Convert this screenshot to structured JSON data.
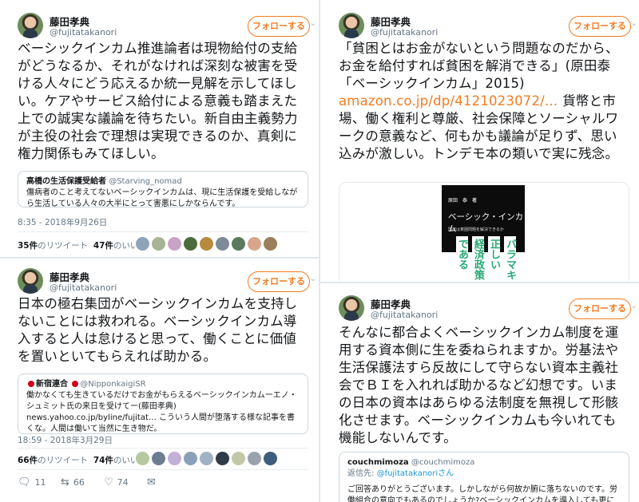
{
  "tweets": [
    {
      "user_name": "藤田孝典",
      "handle": "@fujitatakanori",
      "follow_label": "フォローする",
      "text": "ベーシックインカム推進論者は現物給付の支給がどうなるか、それがなければ深刻な被害を受ける人々にどう応えるか統一見解を示してほしい。ケアやサービス給付による意義も踏まえた上での誠実な議論を待ちたい。新自由主義勢力が主役の社会で理想は実現できるのか、真剣に権力関係もみてほしい。",
      "quote": {
        "name": "高橋の生活保護受給者",
        "handle": "@Starving_nomad",
        "body": "傷病者のこと考えてないベーシックインカムは、現に生活保護を受給しながら生活している人々の大半にとって害悪にしかならんです。"
      },
      "timestamp": "8:35 - 2018年9月26日",
      "retweets": "35件",
      "retweets_label": "のリツイート",
      "likes": "47件",
      "likes_label": "のいいね"
    },
    {
      "user_name": "藤田孝典",
      "handle": "@fujitatakanori",
      "follow_label": "フォローする",
      "text_before": "「貧困とはお金がないという問題なのだから、お金を給付すれば貧困を解消できる」(原田泰「ベーシックインカム」2015)",
      "link": "amazon.co.jp/dp/4121023072/…",
      "text_after": "貨幣と市場、働く権利と尊厳、社会保障とソーシャルワークの意義など、何もかも議論が足りず、思い込みが激しい。トンデモ本の類いで実に残念。",
      "book": {
        "author": "原田　泰　著",
        "title": "ベーシック・インカム",
        "subtitle": "国家は貧困問題を解決できるか",
        "vertical_lines": [
          "バラマキ",
          "正しい",
          "経済政策",
          "である"
        ]
      }
    },
    {
      "user_name": "藤田孝典",
      "handle": "@fujitatakanori",
      "follow_label": "フォローする",
      "text": "日本の極右集団がベーシックインカムを支持しないことには救われる。ベーシックインカム導入すると人は怠けると思って、働くことに価値を置いといてもらえれば助かる。",
      "quote": {
        "name": "新宿連合",
        "handle": "@NipponkaigiSR",
        "body": "働かなくても生きているだけでお金がもらえるベーシックインカムーエノ・シュミット氏の来日を受けてー(藤田孝典) news.yahoo.co.jp/byline/fujitat… こういう人間が堕落する様な記事を書くな。人間は働いて当然に生き物だ。"
      },
      "timestamp": "18:59 - 2018年3月29日",
      "retweets": "66件",
      "retweets_label": "のリツイート",
      "likes": "74件",
      "likes_label": "のいいね",
      "actions": {
        "reply": "11",
        "retweet": "66",
        "like": "74"
      }
    },
    {
      "user_name": "藤田孝典",
      "handle": "@fujitatakanori",
      "follow_label": "フォローする",
      "text": "そんなに都合よくベーシックインカム制度を運用する資本側に生を委ねられますか。労基法や生活保護法すら反故にして守らない資本主義社会でＢＩを入れれば助かるなど幻想です。いまの日本の資本はあらゆる法制度を無視して形骸化させます。ベーシックインカムも今いれても機能しないんです。",
      "reply": {
        "name": "couchmimoza",
        "handle": "@couchmimoza",
        "to_prefix": "返信先: ",
        "to_handle": "@fujitatakanoriさん",
        "body": "ご回答ありがとうございます。しかしながら何故か腑に落ちないのです。労働組合の意向でもあるのでしょうか?ベーシックインカムを導入しても更に必要な方への支援"
      }
    }
  ],
  "colors": {
    "accent": "#f47b20",
    "muted": "#657786",
    "border": "#e1e8ed",
    "text": "#14171a",
    "link_blue": "#1b95e0",
    "book_green": "#2aa876"
  },
  "icons": {
    "reply": "reply-icon",
    "retweet": "retweet-icon",
    "like": "heart-icon",
    "dm": "message-icon"
  }
}
